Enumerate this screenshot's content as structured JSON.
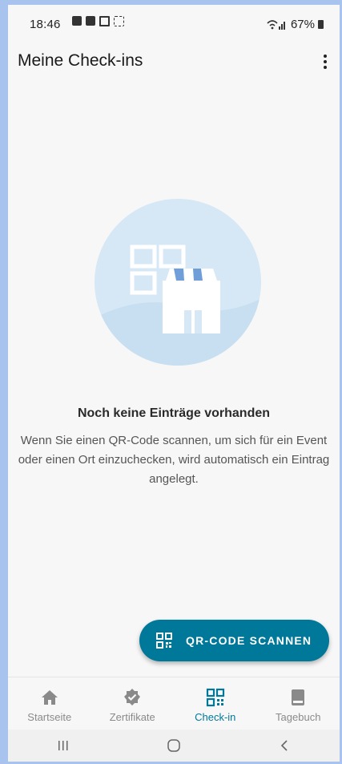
{
  "status_bar": {
    "time": "18:46",
    "battery": "67%"
  },
  "app_bar": {
    "title": "Meine Check-ins",
    "more_icon": "more-vert-icon"
  },
  "empty_state": {
    "illustration_icon": "store-qr-illustration",
    "title": "Noch keine Einträge vorhanden",
    "text": "Wenn Sie einen QR-Code scannen, um sich für ein Event oder einen Ort einzuchecken, wird automatisch ein Eintrag angelegt."
  },
  "fab": {
    "label": "QR-CODE SCANNEN",
    "icon": "qr-code-icon"
  },
  "bottom_nav": {
    "items": [
      {
        "label": "Startseite",
        "icon": "home-icon",
        "active": false
      },
      {
        "label": "Zertifikate",
        "icon": "certificate-icon",
        "active": false
      },
      {
        "label": "Check-in",
        "icon": "qr-code-icon",
        "active": true
      },
      {
        "label": "Tagebuch",
        "icon": "book-icon",
        "active": false
      }
    ]
  },
  "colors": {
    "accent": "#00789a",
    "background": "#f7f7f7",
    "illustration_circle": "#d6e8f5",
    "inactive_nav": "#8a8a8a"
  }
}
